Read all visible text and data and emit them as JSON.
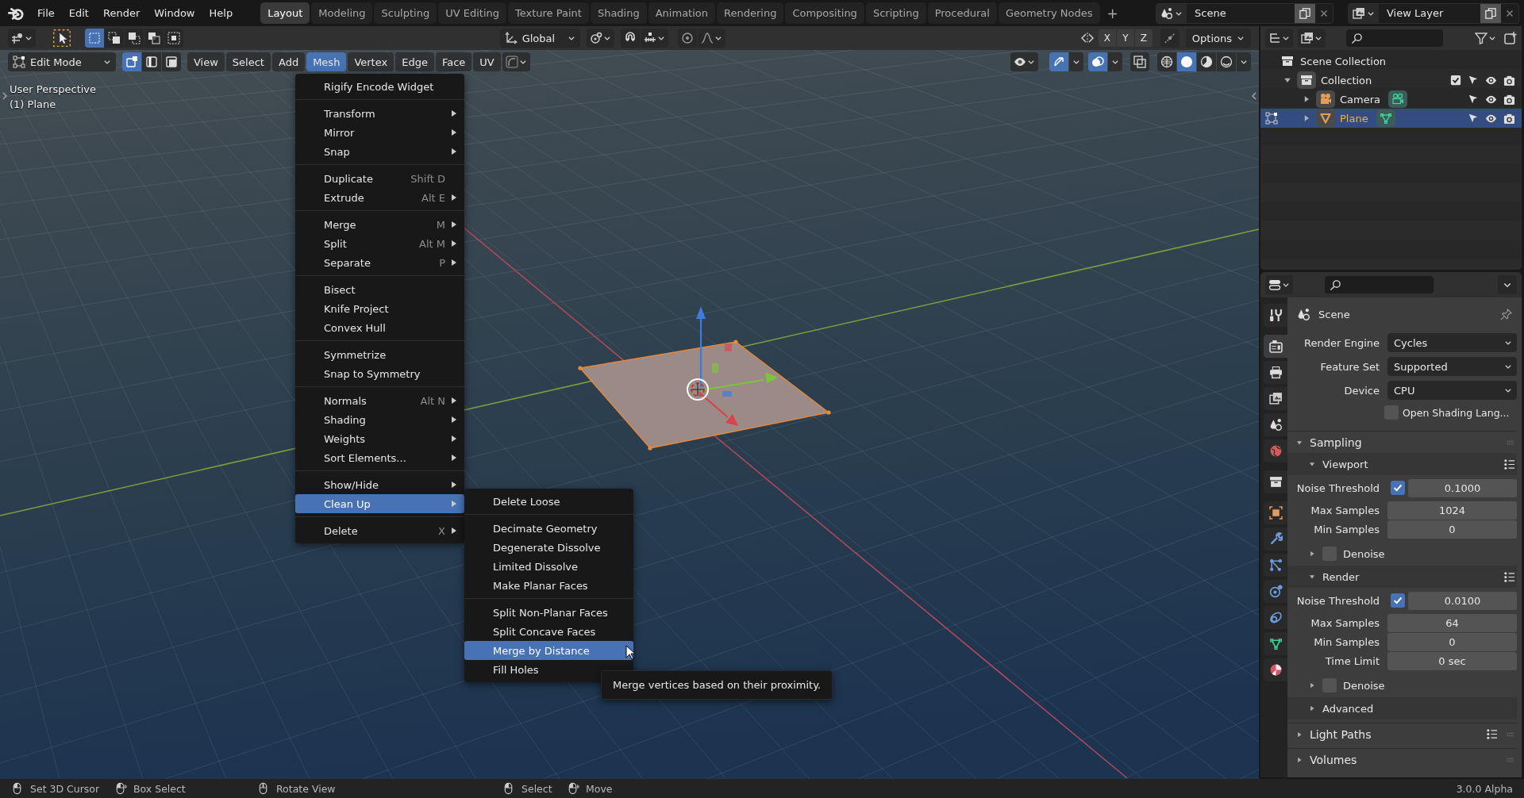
{
  "topbar": {
    "menus": [
      "File",
      "Edit",
      "Render",
      "Window",
      "Help"
    ],
    "workspaces": [
      {
        "label": "Layout",
        "selected": true
      },
      {
        "label": "Modeling",
        "selected": false
      },
      {
        "label": "Sculpting",
        "selected": false
      },
      {
        "label": "UV Editing",
        "selected": false
      },
      {
        "label": "Texture Paint",
        "selected": false
      },
      {
        "label": "Shading",
        "selected": false
      },
      {
        "label": "Animation",
        "selected": false
      },
      {
        "label": "Rendering",
        "selected": false
      },
      {
        "label": "Compositing",
        "selected": false
      },
      {
        "label": "Scripting",
        "selected": false
      },
      {
        "label": "Procedural",
        "selected": false
      },
      {
        "label": "Geometry Nodes",
        "selected": false
      }
    ],
    "add_tab": "+",
    "scene": "Scene",
    "view_layer": "View Layer"
  },
  "tool_header": {
    "orientation": "Global",
    "axes": [
      "X",
      "Y",
      "Z"
    ],
    "options": "Options"
  },
  "viewport_header": {
    "mode": "Edit Mode",
    "select_modes": [
      {
        "kind": "vertex",
        "selected": true
      },
      {
        "kind": "edge",
        "selected": false
      },
      {
        "kind": "face",
        "selected": false
      }
    ],
    "menus": [
      {
        "label": "View",
        "selected": false
      },
      {
        "label": "Select",
        "selected": false
      },
      {
        "label": "Add",
        "selected": false
      },
      {
        "label": "Mesh",
        "selected": true
      },
      {
        "label": "Vertex",
        "selected": false
      },
      {
        "label": "Edge",
        "selected": false
      },
      {
        "label": "Face",
        "selected": false
      },
      {
        "label": "UV",
        "selected": false
      }
    ],
    "gizmos_on": true,
    "overlays_on": true,
    "shading": [
      {
        "kind": "wireframe",
        "selected": false
      },
      {
        "kind": "solid",
        "selected": true
      },
      {
        "kind": "material",
        "selected": false
      },
      {
        "kind": "rendered",
        "selected": false
      }
    ]
  },
  "viewport": {
    "view_name": "User Perspective",
    "object_name": "(1) Plane"
  },
  "mesh_menu": {
    "items": [
      {
        "kind": "item",
        "label": "Rigify Encode Widget",
        "submenu": false,
        "selected": false
      },
      {
        "kind": "separator"
      },
      {
        "kind": "item",
        "label": "Transform",
        "submenu": true,
        "selected": false
      },
      {
        "kind": "item",
        "label": "Mirror",
        "submenu": true,
        "selected": false
      },
      {
        "kind": "item",
        "label": "Snap",
        "submenu": true,
        "selected": false
      },
      {
        "kind": "separator"
      },
      {
        "kind": "item",
        "label": "Duplicate",
        "shortcut": "Shift D",
        "submenu": false,
        "selected": false
      },
      {
        "kind": "item",
        "label": "Extrude",
        "shortcut": "Alt E",
        "submenu": true,
        "selected": false
      },
      {
        "kind": "separator"
      },
      {
        "kind": "item",
        "label": "Merge",
        "shortcut": "M",
        "submenu": true,
        "selected": false
      },
      {
        "kind": "item",
        "label": "Split",
        "shortcut": "Alt M",
        "submenu": true,
        "selected": false
      },
      {
        "kind": "item",
        "label": "Separate",
        "shortcut": "P",
        "submenu": true,
        "selected": false
      },
      {
        "kind": "separator"
      },
      {
        "kind": "item",
        "label": "Bisect",
        "submenu": false,
        "selected": false
      },
      {
        "kind": "item",
        "label": "Knife Project",
        "submenu": false,
        "selected": false
      },
      {
        "kind": "item",
        "label": "Convex Hull",
        "submenu": false,
        "selected": false
      },
      {
        "kind": "separator"
      },
      {
        "kind": "item",
        "label": "Symmetrize",
        "submenu": false,
        "selected": false
      },
      {
        "kind": "item",
        "label": "Snap to Symmetry",
        "submenu": false,
        "selected": false
      },
      {
        "kind": "separator"
      },
      {
        "kind": "item",
        "label": "Normals",
        "shortcut": "Alt N",
        "submenu": true,
        "selected": false
      },
      {
        "kind": "item",
        "label": "Shading",
        "submenu": true,
        "selected": false
      },
      {
        "kind": "item",
        "label": "Weights",
        "submenu": true,
        "selected": false
      },
      {
        "kind": "item",
        "label": "Sort Elements...",
        "submenu": true,
        "selected": false
      },
      {
        "kind": "separator"
      },
      {
        "kind": "item",
        "label": "Show/Hide",
        "submenu": true,
        "selected": false
      },
      {
        "kind": "item",
        "label": "Clean Up",
        "submenu": true,
        "selected": true
      },
      {
        "kind": "separator"
      },
      {
        "kind": "item",
        "label": "Delete",
        "shortcut": "X",
        "submenu": true,
        "selected": false
      }
    ]
  },
  "cleanup_menu": {
    "items": [
      {
        "kind": "item",
        "label": "Delete Loose",
        "submenu": false,
        "selected": false
      },
      {
        "kind": "separator"
      },
      {
        "kind": "item",
        "label": "Decimate Geometry",
        "submenu": false,
        "selected": false
      },
      {
        "kind": "item",
        "label": "Degenerate Dissolve",
        "submenu": false,
        "selected": false
      },
      {
        "kind": "item",
        "label": "Limited Dissolve",
        "submenu": false,
        "selected": false
      },
      {
        "kind": "item",
        "label": "Make Planar Faces",
        "submenu": false,
        "selected": false
      },
      {
        "kind": "separator"
      },
      {
        "kind": "item",
        "label": "Split Non-Planar Faces",
        "submenu": false,
        "selected": false
      },
      {
        "kind": "item",
        "label": "Split Concave Faces",
        "submenu": false,
        "selected": false
      },
      {
        "kind": "item",
        "label": "Merge by Distance",
        "submenu": false,
        "selected": true
      },
      {
        "kind": "item",
        "label": "Fill Holes",
        "submenu": false,
        "selected": false
      }
    ]
  },
  "tooltip": "Merge vertices based on their proximity.",
  "outliner": {
    "root": "Scene Collection",
    "items": [
      {
        "kind": "collection",
        "label": "Collection",
        "expanded": true,
        "checked": true,
        "selected": false,
        "children": [
          {
            "kind": "camera",
            "label": "Camera",
            "expanded": false,
            "selected": false,
            "edit_mode": false
          },
          {
            "kind": "mesh",
            "label": "Plane",
            "expanded": false,
            "selected": true,
            "edit_mode": true
          }
        ]
      }
    ]
  },
  "properties": {
    "context": "Scene",
    "tabs": [
      {
        "kind": "tool",
        "selected": false
      },
      {
        "kind": "render",
        "selected": true
      },
      {
        "kind": "output",
        "selected": false
      },
      {
        "kind": "view_layer",
        "selected": false
      },
      {
        "kind": "scene",
        "selected": false
      },
      {
        "kind": "world",
        "selected": false
      },
      {
        "kind": "collection",
        "selected": false
      },
      {
        "kind": "object",
        "selected": false
      },
      {
        "kind": "modifiers",
        "selected": false
      },
      {
        "kind": "particles",
        "selected": false
      },
      {
        "kind": "physics",
        "selected": false
      },
      {
        "kind": "constraints",
        "selected": false
      },
      {
        "kind": "data",
        "selected": false
      },
      {
        "kind": "material",
        "selected": false
      }
    ],
    "rows": [
      {
        "kind": "dropdown",
        "label": "Render Engine",
        "value": "Cycles"
      },
      {
        "kind": "dropdown",
        "label": "Feature Set",
        "value": "Supported"
      },
      {
        "kind": "dropdown",
        "label": "Device",
        "value": "CPU"
      },
      {
        "kind": "checkbox",
        "label": "Open Shading Lang...",
        "checked": false
      },
      {
        "kind": "panel",
        "label": "Sampling",
        "expanded": true,
        "presets": false
      },
      {
        "kind": "subpanel",
        "label": "Viewport",
        "expanded": true,
        "presets": true
      },
      {
        "kind": "check_number",
        "label": "Noise Threshold",
        "checked": true,
        "value": "0.1000"
      },
      {
        "kind": "number",
        "label": "Max Samples",
        "value": "1024"
      },
      {
        "kind": "number",
        "label": "Min Samples",
        "value": "0"
      },
      {
        "kind": "sub_check",
        "label": "Denoise",
        "expanded": false,
        "checked": false
      },
      {
        "kind": "subpanel",
        "label": "Render",
        "expanded": true,
        "presets": true
      },
      {
        "kind": "check_number",
        "label": "Noise Threshold",
        "checked": true,
        "value": "0.0100"
      },
      {
        "kind": "number",
        "label": "Max Samples",
        "value": "64"
      },
      {
        "kind": "number",
        "label": "Min Samples",
        "value": "0"
      },
      {
        "kind": "number",
        "label": "Time Limit",
        "value": "0 sec"
      },
      {
        "kind": "sub_check",
        "label": "Denoise",
        "expanded": false,
        "checked": false
      },
      {
        "kind": "subpanel",
        "label": "Advanced",
        "expanded": false,
        "presets": false
      },
      {
        "kind": "panel",
        "label": "Light Paths",
        "expanded": false,
        "presets": true
      },
      {
        "kind": "panel",
        "label": "Volumes",
        "expanded": false,
        "presets": false
      }
    ]
  },
  "status_bar": {
    "hints": [
      {
        "kind": "left",
        "label": "Set 3D Cursor"
      },
      {
        "kind": "drag",
        "label": "Box Select"
      },
      {
        "kind": "middle",
        "label": "Rotate View"
      },
      {
        "kind": "left",
        "label": "Select"
      },
      {
        "kind": "drag",
        "label": "Move"
      }
    ],
    "version": "3.0.0 Alpha"
  }
}
